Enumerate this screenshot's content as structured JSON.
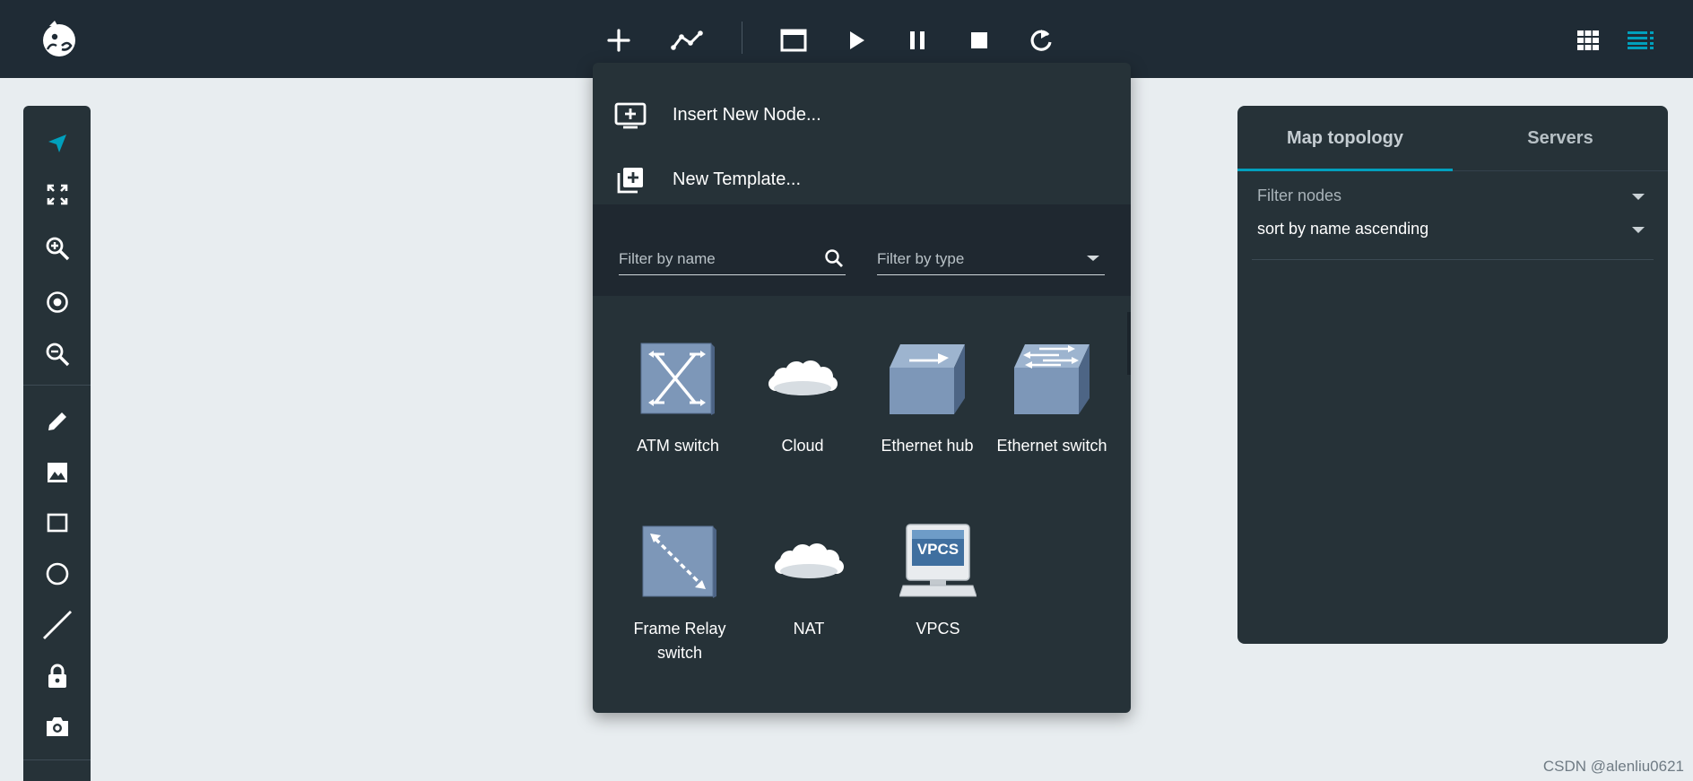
{
  "app": {
    "logo_icon": "chameleon-logo-icon",
    "accent_color": "#00a0bd",
    "toolbar_color": "#1f2b35",
    "panel_color": "#263238"
  },
  "toolbar": {
    "left_buttons": [
      {
        "icon": "plus-icon",
        "tooltip": ""
      },
      {
        "icon": "link-line-icon",
        "tooltip": ""
      }
    ],
    "control_buttons": [
      {
        "icon": "console-window-icon"
      },
      {
        "icon": "play-icon"
      },
      {
        "icon": "pause-icon"
      },
      {
        "icon": "stop-icon"
      },
      {
        "icon": "reload-icon"
      }
    ],
    "right_buttons": [
      {
        "icon": "grid-view-icon"
      },
      {
        "icon": "list-view-icon",
        "active": true
      }
    ]
  },
  "tool_rail": {
    "tools": [
      {
        "icon": "select-arrow-icon",
        "active": true
      },
      {
        "icon": "fit-screen-icon"
      },
      {
        "icon": "zoom-in-icon"
      },
      {
        "icon": "center-target-icon"
      },
      {
        "icon": "zoom-out-icon"
      },
      {
        "icon": "pencil-icon"
      },
      {
        "icon": "image-icon"
      },
      {
        "icon": "rectangle-icon"
      },
      {
        "icon": "circle-icon"
      },
      {
        "icon": "line-icon"
      },
      {
        "icon": "lock-icon"
      },
      {
        "icon": "camera-icon"
      }
    ]
  },
  "add_menu": {
    "insert_node_label": "Insert New Node...",
    "new_template_label": "New Template...",
    "filter_name_placeholder": "Filter by name",
    "filter_type_placeholder": "Filter by type",
    "nodes": [
      {
        "label": "ATM switch",
        "icon": "atm-switch-icon"
      },
      {
        "label": "Cloud",
        "icon": "cloud-icon"
      },
      {
        "label": "Ethernet hub",
        "icon": "ethernet-hub-icon"
      },
      {
        "label": "Ethernet switch",
        "icon": "ethernet-switch-icon"
      },
      {
        "label": "Frame Relay switch",
        "icon": "frame-relay-switch-icon"
      },
      {
        "label": "NAT",
        "icon": "nat-cloud-icon"
      },
      {
        "label": "VPCS",
        "icon": "vpcs-computer-icon",
        "screen_text": "VPCS"
      }
    ]
  },
  "right_panel": {
    "tabs": [
      {
        "label": "Map topology",
        "active": true
      },
      {
        "label": "Servers",
        "active": false
      }
    ],
    "filter_nodes_label": "Filter nodes",
    "sort_value": "sort by name ascending"
  },
  "watermark": "CSDN @alenliu0621"
}
